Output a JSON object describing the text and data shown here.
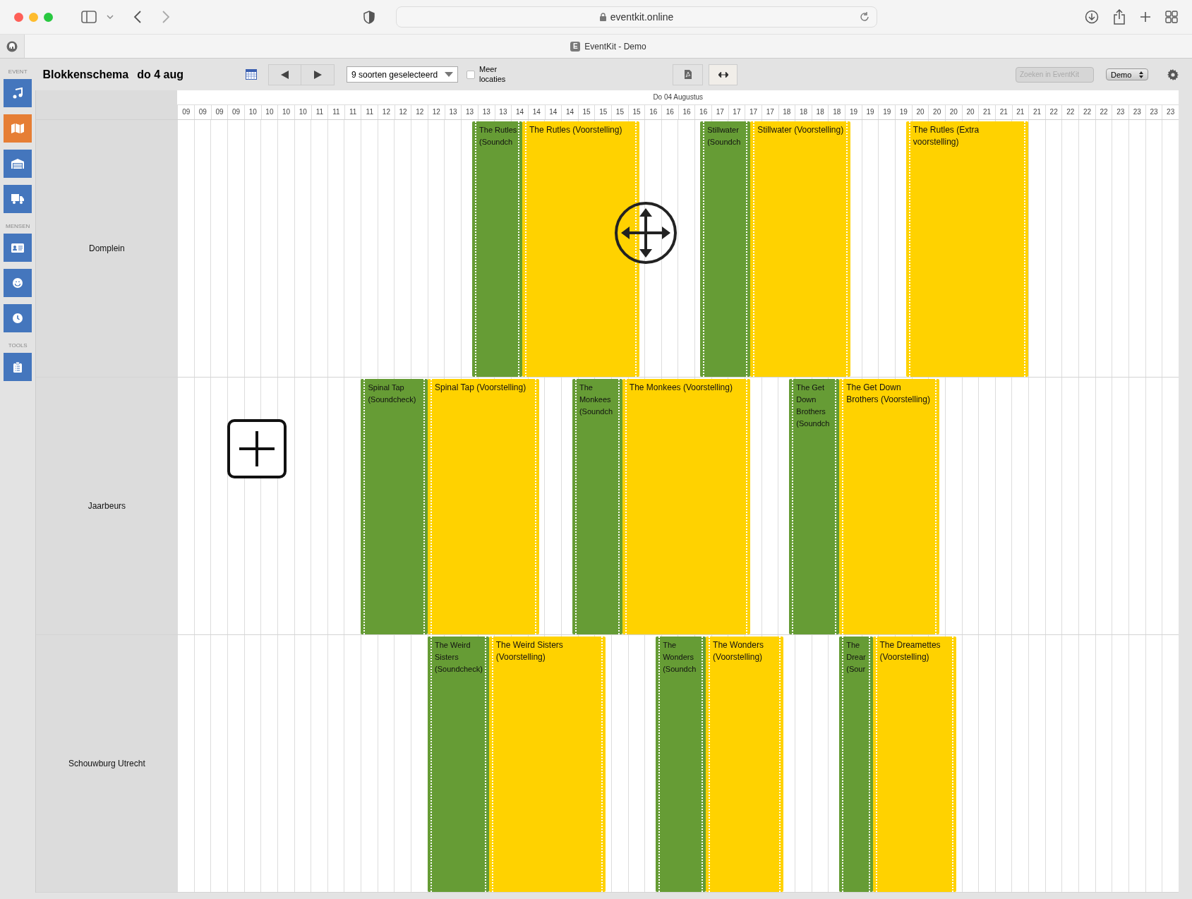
{
  "browser": {
    "url": "eventkit.online",
    "tab_title": "EventKit - Demo",
    "tab_badge": "E"
  },
  "sidebar": {
    "sections": [
      {
        "label": "EVENT",
        "items": [
          {
            "selected": false
          },
          {
            "selected": true
          },
          {
            "selected": false
          },
          {
            "selected": false
          }
        ]
      },
      {
        "label": "MENSEN",
        "items": [
          {
            "selected": false
          },
          {
            "selected": false
          },
          {
            "selected": false
          }
        ]
      },
      {
        "label": "TOOLS",
        "items": [
          {
            "selected": false
          }
        ]
      }
    ]
  },
  "header": {
    "title": "Blokkenschema",
    "date": "do 4 aug",
    "filter": "9 soorten geselecteerd",
    "more_locations": {
      "label": "Meer locaties",
      "checked": false
    },
    "search": {
      "placeholder": "Zoeken in EventKit"
    },
    "account": "Demo"
  },
  "timeline": {
    "date": "Do 04 Augustus",
    "hours": [
      "09",
      "09",
      "09",
      "09",
      "10",
      "10",
      "10",
      "10",
      "11",
      "11",
      "11",
      "11",
      "12",
      "12",
      "12",
      "12",
      "13",
      "13",
      "13",
      "13",
      "14",
      "14",
      "14",
      "14",
      "15",
      "15",
      "15",
      "15",
      "16",
      "16",
      "16",
      "16",
      "17",
      "17",
      "17",
      "17",
      "18",
      "18",
      "18",
      "18",
      "19",
      "19",
      "19",
      "19",
      "20",
      "20",
      "20",
      "20",
      "21",
      "21",
      "21",
      "21",
      "22",
      "22",
      "22",
      "22",
      "23",
      "23",
      "23",
      "23"
    ]
  },
  "locations": [
    {
      "name": "Domplein",
      "events": [
        {
          "kind": "soundcheck",
          "label": "The Rutles (Soundch"
        },
        {
          "kind": "show",
          "label": "The Rutles (Voorstelling)"
        },
        {
          "kind": "soundcheck",
          "label": "Stillwater (Soundch"
        },
        {
          "kind": "show",
          "label": "Stillwater (Voorstelling)"
        },
        {
          "kind": "show",
          "label": "The Rutles (Extra voorstelling)"
        }
      ]
    },
    {
      "name": "Jaarbeurs",
      "events": [
        {
          "kind": "soundcheck",
          "label": "Spinal Tap (Soundcheck)"
        },
        {
          "kind": "show",
          "label": "Spinal Tap (Voorstelling)"
        },
        {
          "kind": "soundcheck",
          "label": "The Monkees (Soundch"
        },
        {
          "kind": "show",
          "label": "The Monkees (Voorstelling)"
        },
        {
          "kind": "soundcheck",
          "label": "The Get Down Brothers (Soundch"
        },
        {
          "kind": "show",
          "label": "The Get Down Brothers (Voorstelling)"
        }
      ]
    },
    {
      "name": "Schouwburg Utrecht",
      "events": [
        {
          "kind": "soundcheck",
          "label": "The Weird Sisters (Soundcheck)"
        },
        {
          "kind": "show",
          "label": "The Weird Sisters (Voorstelling)"
        },
        {
          "kind": "soundcheck",
          "label": "The Wonders (Soundch"
        },
        {
          "kind": "show",
          "label": "The Wonders (Voorstelling)"
        },
        {
          "kind": "soundcheck",
          "label": "The Drear (Sour"
        },
        {
          "kind": "show",
          "label": "The Dreamettes (Voorstelling)"
        }
      ]
    }
  ]
}
